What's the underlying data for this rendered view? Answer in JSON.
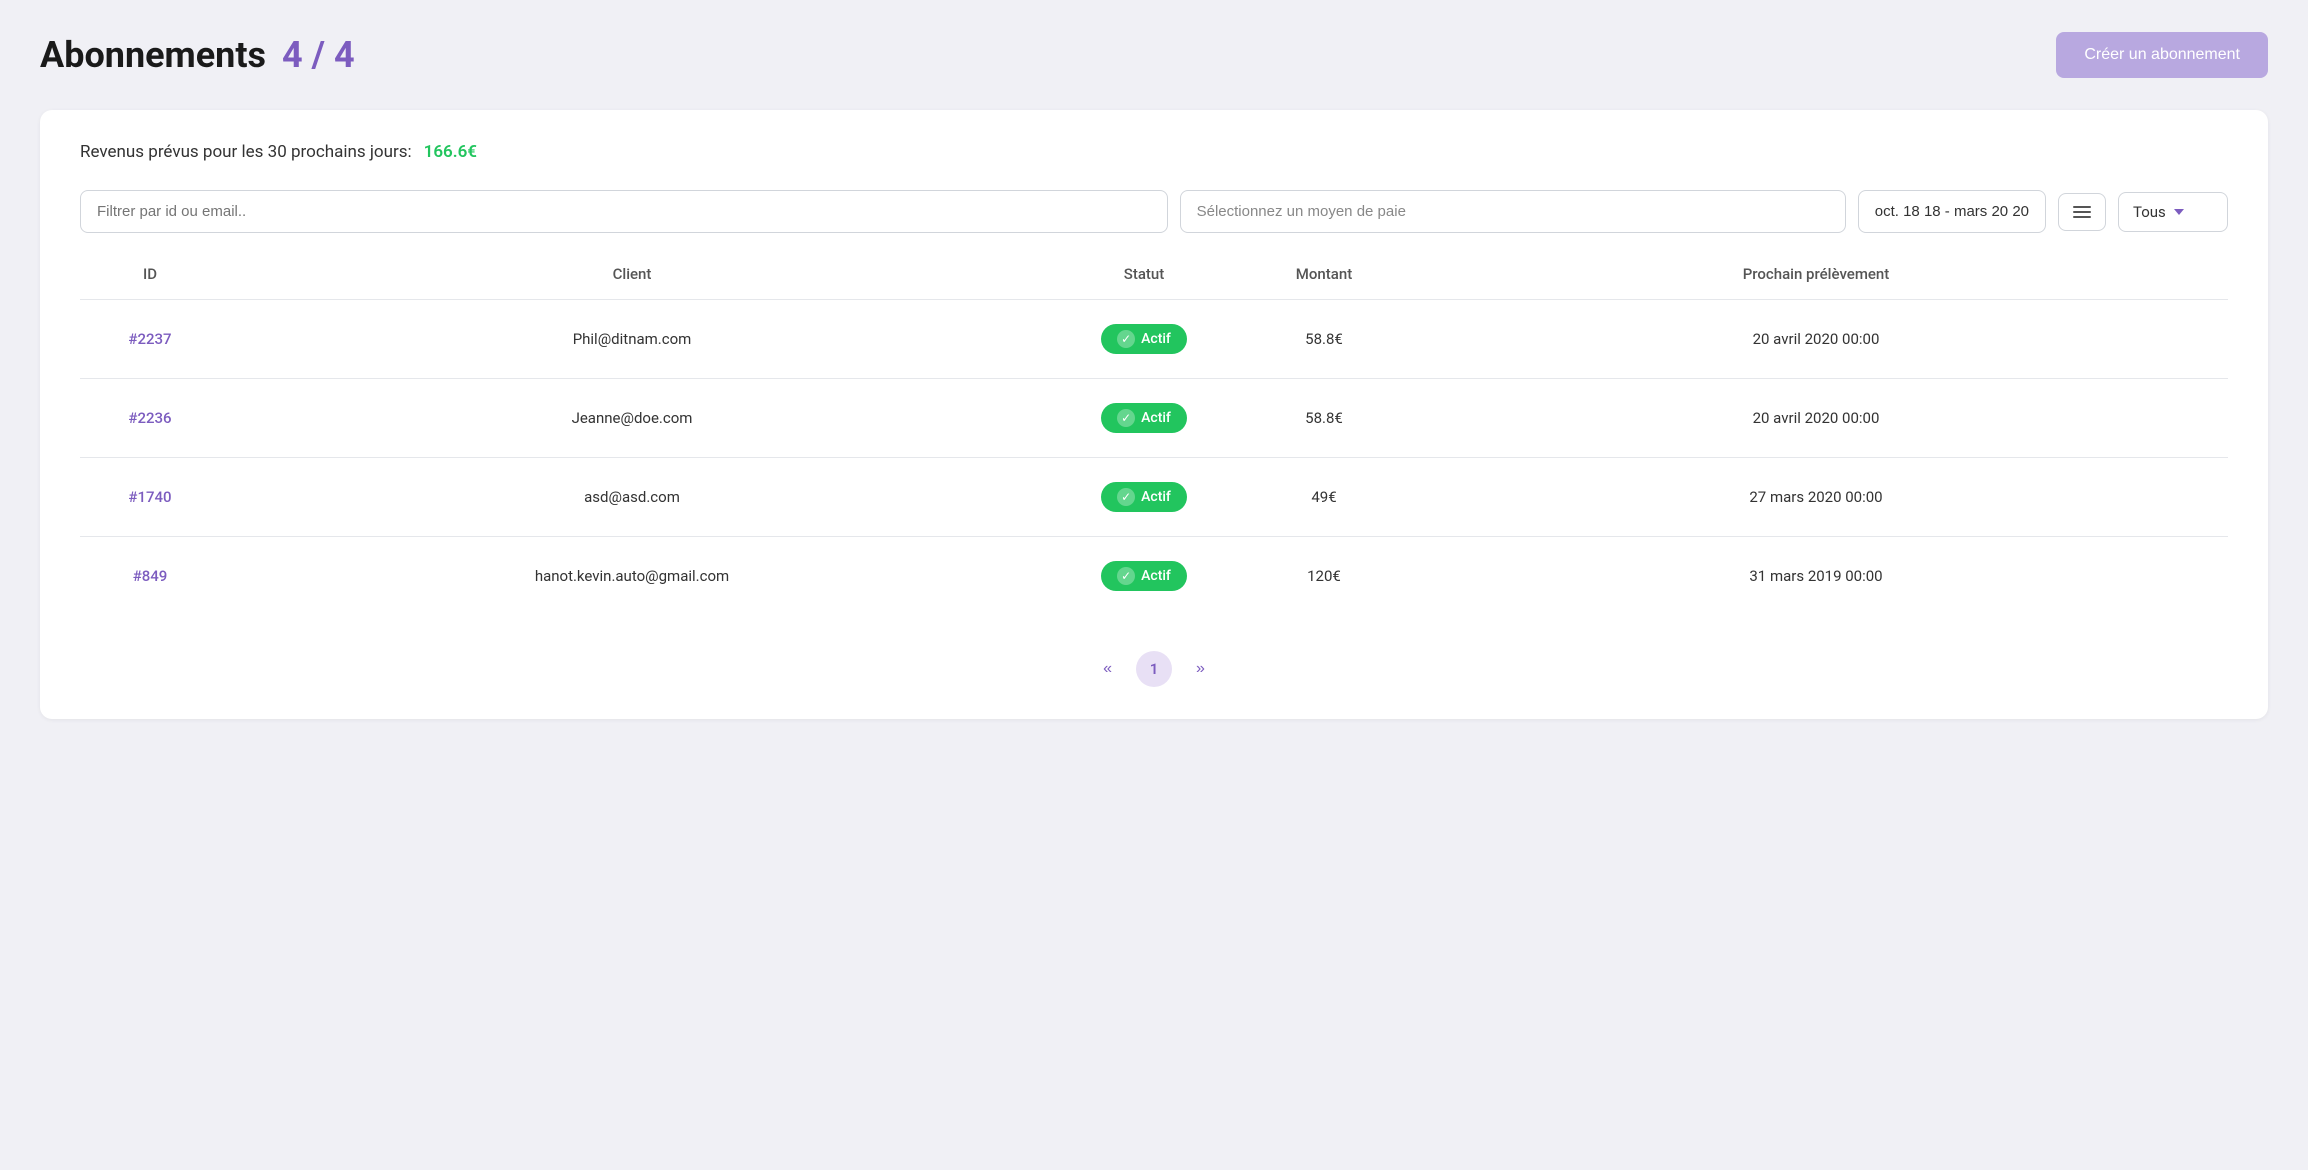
{
  "header": {
    "title": "Abonnements",
    "count": "4 / 4",
    "create_button_label": "Créer un abonnement"
  },
  "revenue": {
    "label": "Revenus prévus pour les 30 prochains jours:",
    "amount": "166.6€"
  },
  "filters": {
    "id_email_placeholder": "Filtrer par id ou email..",
    "payment_method_placeholder": "Sélectionnez un moyen de paie",
    "date_range": "oct. 18 18 - mars 20 20",
    "status_label": "Tous"
  },
  "table": {
    "columns": [
      "ID",
      "Client",
      "Statut",
      "Montant",
      "Prochain prélèvement"
    ],
    "rows": [
      {
        "id": "#2237",
        "client": "Phil@ditnam.com",
        "status": "Actif",
        "amount": "58.8€",
        "next_charge": "20 avril 2020 00:00"
      },
      {
        "id": "#2236",
        "client": "Jeanne@doe.com",
        "status": "Actif",
        "amount": "58.8€",
        "next_charge": "20 avril 2020 00:00"
      },
      {
        "id": "#1740",
        "client": "asd@asd.com",
        "status": "Actif",
        "amount": "49€",
        "next_charge": "27 mars 2020 00:00"
      },
      {
        "id": "#849",
        "client": "hanot.kevin.auto@gmail.com",
        "status": "Actif",
        "amount": "120€",
        "next_charge": "31 mars 2019 00:00"
      }
    ]
  },
  "pagination": {
    "prev": "«",
    "current_page": "1",
    "next": "»"
  }
}
